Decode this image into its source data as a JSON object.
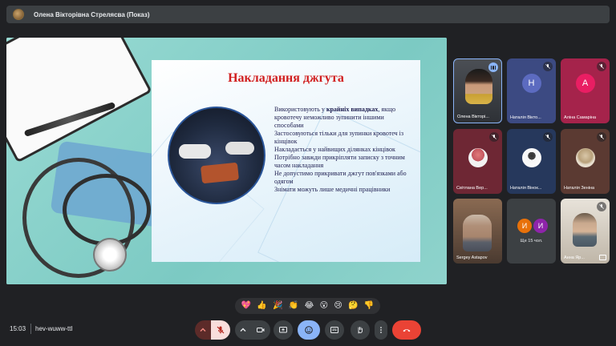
{
  "header": {
    "presenter_name": "Олена Вікторівна Стрелясва (Показ)"
  },
  "slide": {
    "title": "Накладання джгута",
    "lines": [
      {
        "pre": "Використовують у ",
        "bold": "крайніх випадках",
        "post": ", якщо кровотечу неможливо зупинити іншими способами"
      },
      {
        "pre": "Застосовуються тільки для зупинки кровотеч із кінцівок",
        "bold": "",
        "post": ""
      },
      {
        "pre": "Накладається у найвищих ділянках кінцівок",
        "bold": "",
        "post": ""
      },
      {
        "pre": "Потрібно завжди прикріпляти записку з точним часом накладання",
        "bold": "",
        "post": ""
      },
      {
        "pre": "Не допустимо прикривати джгут пов'язками або одягом",
        "bold": "",
        "post": ""
      },
      {
        "pre": "Знімати можуть лише медичні працівники",
        "bold": "",
        "post": ""
      }
    ]
  },
  "participants": [
    {
      "name": "Олена Вікторі...",
      "initial": "",
      "color": "#5f6368",
      "muted": false
    },
    {
      "name": "Наталія Вікто...",
      "initial": "H",
      "color": "#5c6bc0",
      "muted": true
    },
    {
      "name": "Аліна Самаріна",
      "initial": "A",
      "color": "#e91e63",
      "muted": true
    },
    {
      "name": "Світлана Вер...",
      "initial": "",
      "color": "#7b2d3b",
      "muted": true
    },
    {
      "name": "Наталія Вінок...",
      "initial": "",
      "color": "#2d3e63",
      "muted": true
    },
    {
      "name": "Наталія Зеніна",
      "initial": "",
      "color": "#5a3d36",
      "muted": true
    },
    {
      "name": "Sergey Astapov",
      "initial": "",
      "color": "#6d4c3d",
      "muted": false
    },
    {
      "name": "Ще 15 чол.",
      "initial": "",
      "color": "#3c4043",
      "muted": false
    },
    {
      "name": "Анна Яр...",
      "initial": "",
      "color": "#c9c2b5",
      "muted": true
    }
  ],
  "more": {
    "circles": [
      {
        "letter": "И",
        "color": "#e8710a"
      },
      {
        "letter": "И",
        "color": "#8e24aa"
      }
    ],
    "label": "Ще 15 чол."
  },
  "reactions": [
    "💖",
    "👍",
    "🎉",
    "👏",
    "😂",
    "😮",
    "😢",
    "🤔",
    "👎"
  ],
  "footer": {
    "time": "15:03",
    "meeting_code": "hev-wuww-ttl"
  },
  "colors": {
    "end_call": "#ea4335",
    "mic_off": "#f28b82",
    "active": "#8ab4f8"
  }
}
